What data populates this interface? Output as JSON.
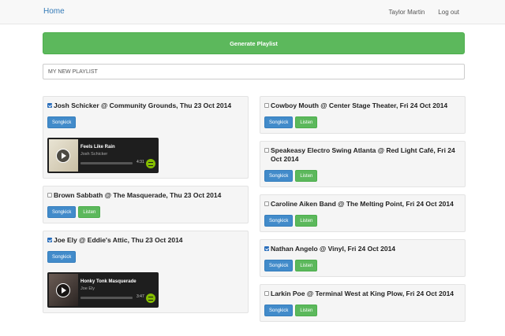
{
  "nav": {
    "brand": "Home",
    "user": "Taylor Martin",
    "logout": "Log out"
  },
  "generate_label": "Generate Playlist",
  "playlist_name": "MY NEW PLAYLIST",
  "buttons": {
    "songkick": "Songkick",
    "listen": "Listen"
  },
  "left": [
    {
      "title": "Josh Schicker @ Community Grounds, Thu 23 Oct 2014",
      "checked": true,
      "listen": false,
      "player": {
        "track": "Feels Like Rain",
        "artist": "Josh Schicker",
        "duration": "4:31"
      }
    },
    {
      "title": "Brown Sabbath @ The Masquerade, Thu 23 Oct 2014",
      "checked": false,
      "listen": true
    },
    {
      "title": "Joe Ely @ Eddie's Attic, Thu 23 Oct 2014",
      "checked": true,
      "listen": false,
      "player": {
        "track": "Honky Tonk Masquerade",
        "artist": "Joe Ely",
        "duration": "3:47"
      }
    }
  ],
  "right": [
    {
      "title": "Cowboy Mouth @ Center Stage Theater, Fri 24 Oct 2014",
      "checked": false,
      "listen": true
    },
    {
      "title": "Speakeasy Electro Swing Atlanta @ Red Light Café, Fri 24 Oct 2014",
      "checked": false,
      "listen": true
    },
    {
      "title": "Caroline Aiken Band @ The Melting Point, Fri 24 Oct 2014",
      "checked": false,
      "listen": true
    },
    {
      "title": "Nathan Angelo @ Vinyl, Fri 24 Oct 2014",
      "checked": true,
      "listen": true
    },
    {
      "title": "Larkin Poe @ Terminal West at King Plow, Fri 24 Oct 2014",
      "checked": false,
      "listen": true
    }
  ]
}
